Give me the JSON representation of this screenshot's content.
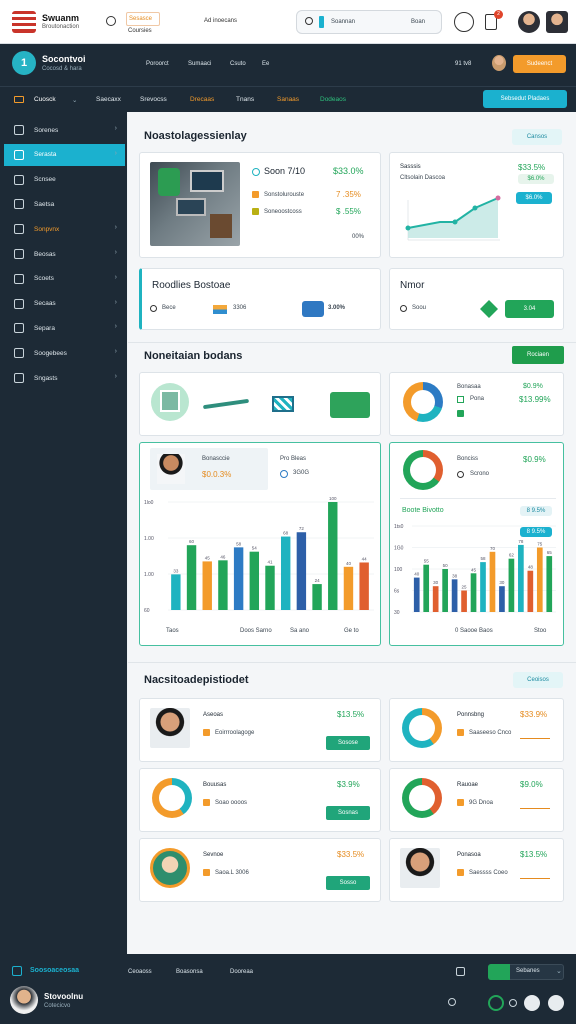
{
  "topbar": {
    "brand_title": "Swuanm",
    "brand_sub": "Broutonaction",
    "link1": "Sesasce",
    "link2": "Coursies",
    "link3": "Ad inoecans",
    "search_placeholder": "Soannan",
    "search_button": "Boan",
    "notif_count": "2"
  },
  "header": {
    "title": "Socontvoi",
    "subtitle": "Cocosd & hara",
    "logo_glyph": "1",
    "links": [
      "Poroorct",
      "Sumaaci",
      "Csuto",
      "Ee"
    ],
    "page_count": "91 tv8",
    "orange_btn": "Sudeenct"
  },
  "nav": {
    "items": [
      {
        "label": "Cuosck",
        "color": "#ffffff"
      },
      {
        "label": "Saecaxx",
        "color": "#dfe7ec"
      },
      {
        "label": "Srevocss",
        "color": "#dfe7ec"
      },
      {
        "label": "Drecaas",
        "color": "#f39b2b"
      },
      {
        "label": "Tnans",
        "color": "#dfe7ec"
      },
      {
        "label": "Sanaas",
        "color": "#f39b2b"
      },
      {
        "label": "Dodeaos",
        "color": "#2ec07d"
      }
    ],
    "cyan_btn": "Sebsedut Pladaes"
  },
  "sidebar": {
    "items": [
      {
        "label": "Sorenes",
        "chev": "›",
        "color": "#dfe7ec"
      },
      {
        "label": "Serasta",
        "chev": "›",
        "color": "#ffffff"
      },
      {
        "label": "Scnsee",
        "chev": "",
        "color": "#dfe7ec"
      },
      {
        "label": "Saetsa",
        "chev": "",
        "color": "#dfe7ec"
      },
      {
        "label": "Sonpvnx",
        "chev": "›",
        "color": "#f39b2b"
      },
      {
        "label": "Beosas",
        "chev": "›",
        "color": "#dfe7ec"
      },
      {
        "label": "Scoets",
        "chev": "›",
        "color": "#dfe7ec"
      },
      {
        "label": "Secaas",
        "chev": "›",
        "color": "#dfe7ec"
      },
      {
        "label": "Separa",
        "chev": "›",
        "color": "#dfe7ec"
      },
      {
        "label": "Soogebees",
        "chev": "›",
        "color": "#dfe7ec"
      },
      {
        "label": "Sngasts",
        "chev": "›",
        "color": "#dfe7ec"
      }
    ]
  },
  "section1": {
    "title": "Noastolagessienlay",
    "pill": "Cansos"
  },
  "card_a": {
    "title": "Soon 7/10",
    "title_val": "$33.0%",
    "row1": "Sonstolurouste",
    "row1_val": "7 .35%",
    "row2": "Soneoostcoss",
    "row2_val": "$ .55%",
    "foot": "00%"
  },
  "card_b": {
    "title": "Sasssis",
    "sub": "Cltsolain Dascoa",
    "val": "$33.5%",
    "pill": "$6.0%"
  },
  "card_c": {
    "title": "Roodlies Bostoae",
    "left": "Bece",
    "val": "3306",
    "val2": "3.00%"
  },
  "card_d": {
    "title": "Nmor",
    "left": "Soou",
    "pill": "3.04"
  },
  "section2": {
    "title": "Noneitaian bodans",
    "btn": "Rociaen"
  },
  "card_e": {},
  "card_f": {
    "label1": "Bonasaa",
    "label2": "Pona",
    "val1": "$0.9%",
    "val2": "$13.99%"
  },
  "card_g": {
    "name": "Bonasccie",
    "val": "$0.0.3%",
    "right_title": "Pro Bleas",
    "right_val": "3G0G",
    "foot1": "Taos",
    "foot2": "Doos Sarno",
    "foot3": "Sa ano",
    "foot4": "Ge to"
  },
  "card_h": {
    "title": "Bonciss",
    "val": "$0.9%",
    "sub": "Scrono",
    "chart_title": "Boote Bivotto",
    "chart_pill": "8 9.5%",
    "foot1": "0 Saooe Baos",
    "foot2": "Stoo"
  },
  "section3": {
    "title": "Nacsitoadepistiodet",
    "pill": "Ceoisos"
  },
  "rows": [
    {
      "name": "Aseoas",
      "sub": "Eoirrroolagoge",
      "val": "$13.5%",
      "btn": "Sosose"
    },
    {
      "name": "Ponnsbng",
      "sub": "Saaseeso Cnco",
      "val": "$33.9%",
      "btn": ""
    },
    {
      "name": "Bouusas",
      "sub": "Soao oooos",
      "val": "$3.9%",
      "btn": "Sosnas"
    },
    {
      "name": "Rauoae",
      "sub": "9G Dnoa",
      "val": "$9.0%",
      "btn": ""
    },
    {
      "name": "Sevnoe",
      "sub": "Saoa.L 3006",
      "val": "$33.5%",
      "btn": "Sosso"
    },
    {
      "name": "Ponasoa",
      "sub": "Saessss Coeo",
      "val": "$13.5%",
      "btn": ""
    }
  ],
  "footer": {
    "brand": "Soosoaceosaa",
    "links": [
      "Ceoaoss",
      "Boasonsa",
      "Dooreaa"
    ],
    "right": "Sebanes",
    "user_name": "Stovoolnu",
    "user_sub": "Cotecicvo"
  },
  "chart_data": [
    {
      "type": "bar",
      "title": "",
      "series": [
        {
          "name": "",
          "values": [
            33,
            60,
            45,
            46,
            58,
            54,
            41,
            68,
            72,
            24,
            100,
            40,
            44
          ]
        }
      ],
      "colors": [
        "#1fb3c0",
        "#22a559",
        "#f39b2b",
        "#22a559",
        "#2d7bc4",
        "#22a559",
        "#22a559",
        "#1fb3c0",
        "#2d5fa8",
        "#22a559",
        "#22a559",
        "#f39b2b",
        "#e05f2f"
      ],
      "ytick_labels": [
        "1lo0",
        "1.00",
        "1.00",
        "60"
      ],
      "ylim": [
        0,
        100
      ]
    },
    {
      "type": "bar",
      "title": "Boote Bivotto",
      "series": [
        {
          "name": "",
          "values": [
            40,
            55,
            30,
            50,
            38,
            25,
            45,
            58,
            70,
            30,
            62,
            78,
            48,
            75,
            65
          ]
        }
      ],
      "colors": [
        "#2d5fa8",
        "#22a559",
        "#e05f2f",
        "#22a559",
        "#2d5fa8",
        "#e05f2f",
        "#22a559",
        "#1fb3c0",
        "#f39b2b",
        "#2d5fa8",
        "#22a559",
        "#1fb3c0",
        "#e05f2f",
        "#f39b2b",
        "#22a559"
      ],
      "ytick_labels": [
        "1ts0",
        "1G0",
        "100",
        "6s",
        "30"
      ],
      "ylim": [
        0,
        100
      ]
    }
  ]
}
